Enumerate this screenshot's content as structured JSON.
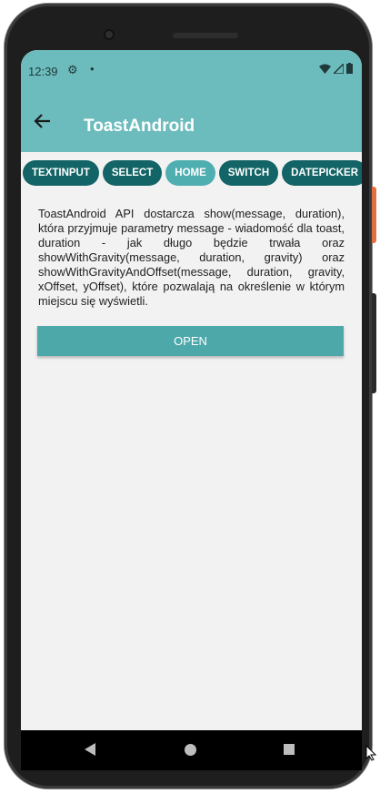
{
  "status_bar": {
    "time": "12:39",
    "gear_icon": "gear-icon",
    "dot": "•"
  },
  "app_bar": {
    "title": "ToastAndroid",
    "back_icon": "arrow-left-icon"
  },
  "tabs": [
    {
      "label": "TEXTINPUT",
      "active": false
    },
    {
      "label": "SELECT",
      "active": false
    },
    {
      "label": "HOME",
      "active": true
    },
    {
      "label": "SWITCH",
      "active": false
    },
    {
      "label": "DATEPICKER",
      "active": false
    }
  ],
  "content": {
    "description": "ToastAndroid API dostarcza show(message, duration), która przyjmuje parametry message - wiadomość dla toast, duration - jak długo będzie trwała oraz showWithGravity(message, duration, gravity) oraz showWithGravityAndOffset(message, duration, gravity, xOffset, yOffset), które pozwalają na określenie w którym miejscu się wyświetli.",
    "open_label": "OPEN"
  },
  "colors": {
    "app_bar": "#6dbcbd",
    "tab": "#136466",
    "tab_active": "#4faeb0",
    "button": "#4da8aa",
    "background": "#f2f2f2"
  }
}
